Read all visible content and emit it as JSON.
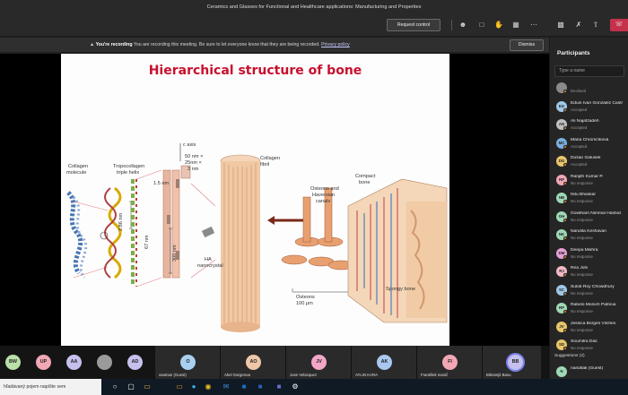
{
  "window": {
    "title": "Ceramics and Glasses for Functional and Healthcare applications: Manufacturing and Properties"
  },
  "toolbar": {
    "request_control_label": "Request control",
    "icons": [
      "people-icon",
      "chat-icon",
      "raise-hand-icon",
      "rooms-icon",
      "more-icon",
      "camera-icon",
      "mic-off-icon",
      "share-icon",
      "leave-icon"
    ]
  },
  "banner": {
    "heading": "You're recording",
    "message": "You are recording this meeting. Be sure to let everyone know that they are being recorded.",
    "policy_link": "Privacy policy",
    "dismiss_label": "Dismiss"
  },
  "slide": {
    "title": "Hierarchical structure of bone",
    "labels": {
      "collagen_molecule": [
        "Collagen",
        "molecule"
      ],
      "tropocollagen": [
        "Tropocollagen",
        "triple helix"
      ],
      "nm15": "1.5 nm",
      "c_axis": "c axis",
      "crystal_dims": [
        "50 nm ×",
        "25nm ×",
        "3 nm"
      ],
      "nm286": "2.86 nm",
      "nm67": "67 nm",
      "nm300": "300 nm",
      "ha": [
        "HA",
        "nanocrystal"
      ],
      "collagen_fibril": [
        "Collagen",
        "fibril"
      ],
      "osteons_haversian": [
        "Osteons and",
        "Haversian",
        "canals"
      ],
      "compact_bone": [
        "Compact",
        "bone"
      ],
      "osteons": "Osteons",
      "um100": "100 μm",
      "spongy_bone": "Spongy bone"
    }
  },
  "participants_panel": {
    "title": "Participants",
    "search_placeholder": "Type a name",
    "people": [
      {
        "initials": "",
        "name": "",
        "status": "Declined",
        "color": "#8a8a8a"
      },
      {
        "initials": "EG",
        "name": "Eduin Ivan González Castr",
        "status": "Accepted",
        "color": "#9fc8e8"
      },
      {
        "initials": "AN",
        "name": "Ali Najafzadeh",
        "status": "Accepted",
        "color": "#bfbfbf"
      },
      {
        "initials": "MC",
        "name": "Mária Chromčíková",
        "status": "Accepted",
        "color": "#7ab0e0"
      },
      {
        "initials": "DG",
        "name": "Dušan Galusek",
        "status": "Accepted",
        "color": "#e8c56b"
      },
      {
        "initials": "RP",
        "name": "Ranjith Kumar P.",
        "status": "No response",
        "color": "#f2a7b5"
      },
      {
        "initials": "NB",
        "name": "Nitu Bhaskar",
        "status": "No response",
        "color": "#9fd8b6"
      },
      {
        "initials": "GH",
        "name": "Gowtham Nimmal Haribat",
        "status": "No response",
        "color": "#9fd8b6"
      },
      {
        "initials": "NK",
        "name": "Nandita Keshavan",
        "status": "No response",
        "color": "#9fd8b6"
      },
      {
        "initials": "DM",
        "name": "Deepa Mishra",
        "status": "No response",
        "color": "#e6a0d6"
      },
      {
        "initials": "RJ",
        "name": "Rea Johi",
        "status": "No response",
        "color": "#f2b9c4"
      },
      {
        "initials": "SC",
        "name": "Sulob Roy Chowdhury",
        "status": "No response",
        "color": "#9fc8e8"
      },
      {
        "initials": "RP",
        "name": "Rabelo Monich Patricia",
        "status": "No response",
        "color": "#9fd8b6"
      },
      {
        "initials": "JV",
        "name": "Jessica Borges Vilches",
        "status": "No response",
        "color": "#e8c56b"
      },
      {
        "initials": "SD",
        "name": "Soumitra Das",
        "status": "No response",
        "color": "#e8c56b"
      }
    ],
    "suggestions_label": "Suggestions (2)",
    "suggestion": {
      "initials": "N",
      "name": "nanditak (Guest)",
      "color": "#9fd8b6"
    }
  },
  "strip": {
    "avatars": [
      {
        "initials": "BW",
        "color": "#b8e0a8"
      },
      {
        "initials": "UP",
        "color": "#f2a7b5"
      },
      {
        "initials": "AA",
        "color": "#c6c0ee"
      },
      {
        "initials": "",
        "color": "#9a9a9a"
      },
      {
        "initials": "AD",
        "color": "#c6c0ee"
      }
    ],
    "tiles": [
      {
        "initials": "O",
        "name": "osaman (Guest)",
        "color": "#a8d0f0"
      },
      {
        "initials": "AO",
        "name": "Abel Gargenoa",
        "color": "#f0c8a8"
      },
      {
        "initials": "JV",
        "name": "Jose Velazquez",
        "color": "#f2a7c8"
      },
      {
        "initials": "AK",
        "name": "AYLIN KARA",
        "color": "#a8c8f0"
      },
      {
        "initials": "FI",
        "name": "František Ivanič",
        "color": "#f2a7b5"
      },
      {
        "initials": "BB",
        "name": "Bikramjit Basu",
        "color": "#c6c0ee"
      }
    ]
  },
  "taskbar": {
    "search_text": "hľadávaný pojem napíšte sem",
    "icons": [
      "cortana-icon",
      "task-view-icon",
      "file-explorer-icon",
      "edge-icon",
      "chrome-icon",
      "mail-icon",
      "outlook-icon",
      "word-icon",
      "teams-icon",
      "settings-icon"
    ]
  }
}
